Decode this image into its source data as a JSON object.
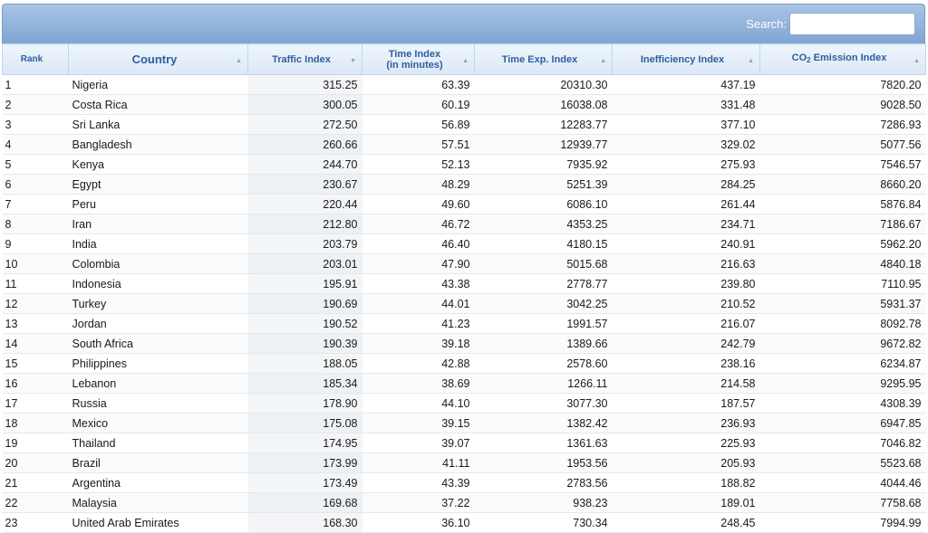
{
  "search": {
    "label": "Search:",
    "value": ""
  },
  "headers": {
    "rank": "Rank",
    "country": "Country",
    "traffic": "Traffic Index",
    "time_line1": "Time Index",
    "time_line2": "(in minutes)",
    "exp": "Time Exp. Index",
    "ineff": "Inefficiency Index",
    "co2_prefix": "CO",
    "co2_sub": "2",
    "co2_suffix": " Emission Index"
  },
  "rows": [
    [
      "1",
      "Nigeria",
      "315.25",
      "63.39",
      "20310.30",
      "437.19",
      "7820.20"
    ],
    [
      "2",
      "Costa Rica",
      "300.05",
      "60.19",
      "16038.08",
      "331.48",
      "9028.50"
    ],
    [
      "3",
      "Sri Lanka",
      "272.50",
      "56.89",
      "12283.77",
      "377.10",
      "7286.93"
    ],
    [
      "4",
      "Bangladesh",
      "260.66",
      "57.51",
      "12939.77",
      "329.02",
      "5077.56"
    ],
    [
      "5",
      "Kenya",
      "244.70",
      "52.13",
      "7935.92",
      "275.93",
      "7546.57"
    ],
    [
      "6",
      "Egypt",
      "230.67",
      "48.29",
      "5251.39",
      "284.25",
      "8660.20"
    ],
    [
      "7",
      "Peru",
      "220.44",
      "49.60",
      "6086.10",
      "261.44",
      "5876.84"
    ],
    [
      "8",
      "Iran",
      "212.80",
      "46.72",
      "4353.25",
      "234.71",
      "7186.67"
    ],
    [
      "9",
      "India",
      "203.79",
      "46.40",
      "4180.15",
      "240.91",
      "5962.20"
    ],
    [
      "10",
      "Colombia",
      "203.01",
      "47.90",
      "5015.68",
      "216.63",
      "4840.18"
    ],
    [
      "11",
      "Indonesia",
      "195.91",
      "43.38",
      "2778.77",
      "239.80",
      "7110.95"
    ],
    [
      "12",
      "Turkey",
      "190.69",
      "44.01",
      "3042.25",
      "210.52",
      "5931.37"
    ],
    [
      "13",
      "Jordan",
      "190.52",
      "41.23",
      "1991.57",
      "216.07",
      "8092.78"
    ],
    [
      "14",
      "South Africa",
      "190.39",
      "39.18",
      "1389.66",
      "242.79",
      "9672.82"
    ],
    [
      "15",
      "Philippines",
      "188.05",
      "42.88",
      "2578.60",
      "238.16",
      "6234.87"
    ],
    [
      "16",
      "Lebanon",
      "185.34",
      "38.69",
      "1266.11",
      "214.58",
      "9295.95"
    ],
    [
      "17",
      "Russia",
      "178.90",
      "44.10",
      "3077.30",
      "187.57",
      "4308.39"
    ],
    [
      "18",
      "Mexico",
      "175.08",
      "39.15",
      "1382.42",
      "236.93",
      "6947.85"
    ],
    [
      "19",
      "Thailand",
      "174.95",
      "39.07",
      "1361.63",
      "225.93",
      "7046.82"
    ],
    [
      "20",
      "Brazil",
      "173.99",
      "41.11",
      "1953.56",
      "205.93",
      "5523.68"
    ],
    [
      "21",
      "Argentina",
      "173.49",
      "43.39",
      "2783.56",
      "188.82",
      "4044.46"
    ],
    [
      "22",
      "Malaysia",
      "169.68",
      "37.22",
      "938.23",
      "189.01",
      "7758.68"
    ],
    [
      "23",
      "United Arab Emirates",
      "168.30",
      "36.10",
      "730.34",
      "248.45",
      "7994.99"
    ]
  ],
  "icons": {
    "sort_asc": "▲",
    "sort_desc": "▼"
  },
  "colors": {
    "header_text": "#2d5f9e",
    "toolbar": "#8eb0da"
  }
}
